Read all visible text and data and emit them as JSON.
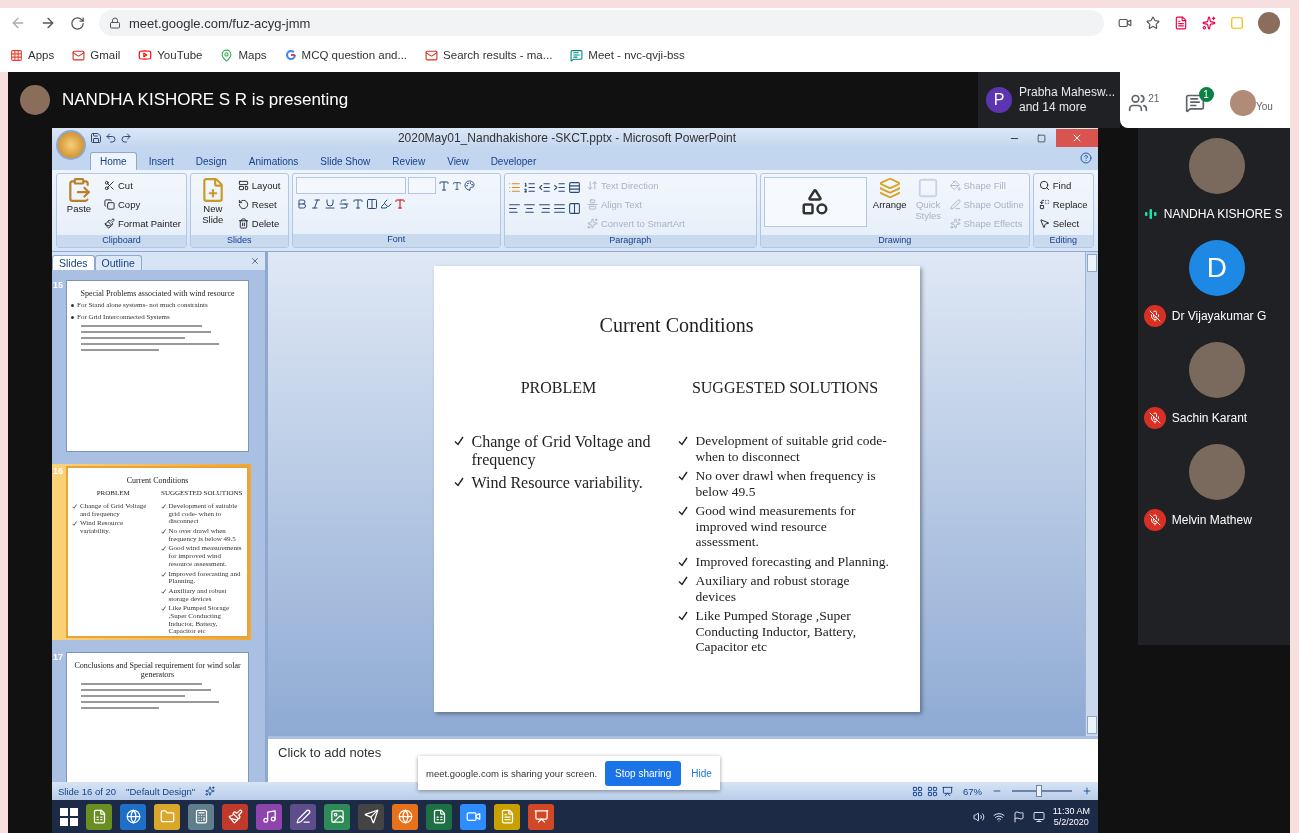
{
  "browser": {
    "url": "meet.google.com/fuz-acyg-jmm",
    "bookmarks": [
      {
        "label": "Apps",
        "kind": "apps"
      },
      {
        "label": "Gmail",
        "kind": "mail"
      },
      {
        "label": "YouTube",
        "kind": "video"
      },
      {
        "label": "Maps",
        "kind": "pin"
      },
      {
        "label": "MCQ question and...",
        "kind": "g"
      },
      {
        "label": "Search results - ma...",
        "kind": "mail"
      },
      {
        "label": "Meet - nvc-qvji-bss",
        "kind": "meet"
      }
    ]
  },
  "meet": {
    "banner": "NANDHA KISHORE S R is presenting",
    "chip": {
      "initial": "P",
      "name": "Prabha Mahesw...",
      "more": "and 14 more"
    },
    "people_count": "21",
    "chat_badge": "1",
    "you_label": "You"
  },
  "powerpoint": {
    "title": "2020May01_Nandhakishore -SKCT.pptx - Microsoft PowerPoint",
    "tabs": [
      {
        "label": "Home",
        "selected": true
      },
      {
        "label": "Insert",
        "selected": false
      },
      {
        "label": "Design",
        "selected": false
      },
      {
        "label": "Animations",
        "selected": false
      },
      {
        "label": "Slide Show",
        "selected": false
      },
      {
        "label": "Review",
        "selected": false
      },
      {
        "label": "View",
        "selected": false
      },
      {
        "label": "Developer",
        "selected": false
      }
    ],
    "clipboard": {
      "name": "Clipboard",
      "paste": "Paste",
      "small": [
        {
          "label": "Cut",
          "disabled": false
        },
        {
          "label": "Copy",
          "disabled": false
        },
        {
          "label": "Format Painter",
          "disabled": false
        }
      ]
    },
    "slides_group": {
      "name": "Slides",
      "new_slide": "New Slide",
      "small": [
        {
          "label": "Layout",
          "disabled": false
        },
        {
          "label": "Reset",
          "disabled": false
        },
        {
          "label": "Delete",
          "disabled": false
        }
      ]
    },
    "font": {
      "name": "Font"
    },
    "paragraph": {
      "name": "Paragraph",
      "small": [
        {
          "label": "Text Direction",
          "disabled": true
        },
        {
          "label": "Align Text",
          "disabled": true
        },
        {
          "label": "Convert to SmartArt",
          "disabled": true
        }
      ]
    },
    "drawing": {
      "name": "Drawing",
      "arrange": {
        "label": "Arrange",
        "disabled": false
      },
      "quick_styles": {
        "label": "Quick Styles",
        "disabled": true
      },
      "small": [
        {
          "label": "Shape Fill",
          "disabled": true
        },
        {
          "label": "Shape Outline",
          "disabled": true
        },
        {
          "label": "Shape Effects",
          "disabled": true
        }
      ]
    },
    "editing": {
      "name": "Editing",
      "small": [
        {
          "label": "Find",
          "disabled": false
        },
        {
          "label": "Replace",
          "disabled": false
        },
        {
          "label": "Select",
          "disabled": false
        }
      ]
    },
    "pane_tabs": [
      {
        "label": "Slides",
        "selected": true
      },
      {
        "label": "Outline",
        "selected": false
      }
    ],
    "thumbnails": [
      {
        "number": "15",
        "selected": false,
        "kind": "bullets",
        "title": "Special Problems associated with wind resource",
        "bullets": [
          "For Stand alone systems- not much constraints",
          "For Grid Interconnected Systems"
        ]
      },
      {
        "number": "16",
        "selected": true,
        "kind": "columns",
        "title": "Current Conditions",
        "columns": [
          {
            "heading": "PROBLEM",
            "bullets": [
              "Change of Grid Voltage and frequency",
              "Wind Resource variability."
            ]
          },
          {
            "heading": "SUGGESTED SOLUTIONS",
            "bullets": [
              "Development of suitable grid code- when to disconnect",
              "No over drawl when frequency is below 49.5",
              "Good  wind measurements for improved wind resource assessment.",
              "Improved forecasting and Planning.",
              "Auxiliary and robust storage devices",
              "Like Pumped Storage ,Super Conducting Inductor, Battery, Capacitor etc"
            ]
          }
        ]
      },
      {
        "number": "17",
        "selected": false,
        "kind": "bullets",
        "title": "Conclusions and Special requirement for wind solar generators"
      }
    ],
    "slide": {
      "title": "Current Conditions",
      "columns": [
        {
          "heading": "PROBLEM",
          "bullets": [
            "Change of Grid Voltage and frequency",
            "Wind Resource variability."
          ]
        },
        {
          "heading": "SUGGESTED SOLUTIONS",
          "bullets": [
            "Development of suitable grid code- when to disconnect",
            "No over drawl when frequency is below 49.5",
            "Good  wind measurements for improved wind resource assessment.",
            "Improved forecasting and Planning.",
            "Auxiliary and robust storage devices",
            "Like Pumped Storage ,Super Conducting Inductor, Battery, Capacitor etc"
          ]
        }
      ]
    },
    "notes_placeholder": "Click to add notes",
    "status": {
      "slide_count": "Slide 16 of 20",
      "theme": "\"Default Design\"",
      "zoom": "67%",
      "zoom_slider": {
        "level": 0.45
      }
    }
  },
  "share_bar": {
    "message": "meet.google.com is sharing your screen.",
    "stop": "Stop sharing",
    "hide": "Hide"
  },
  "taskbar": {
    "time": "11:30 AM",
    "date": "5/2/2020"
  },
  "participants": [
    {
      "name": "NANDHA KISHORE S",
      "muted": false,
      "kind": "photo"
    },
    {
      "name": "Dr Vijayakumar G",
      "muted": true,
      "kind": "letter",
      "initial": "D"
    },
    {
      "name": "Sachin Karant",
      "muted": true,
      "kind": "photo"
    },
    {
      "name": "Melvin Mathew",
      "muted": true,
      "kind": "photo"
    }
  ]
}
